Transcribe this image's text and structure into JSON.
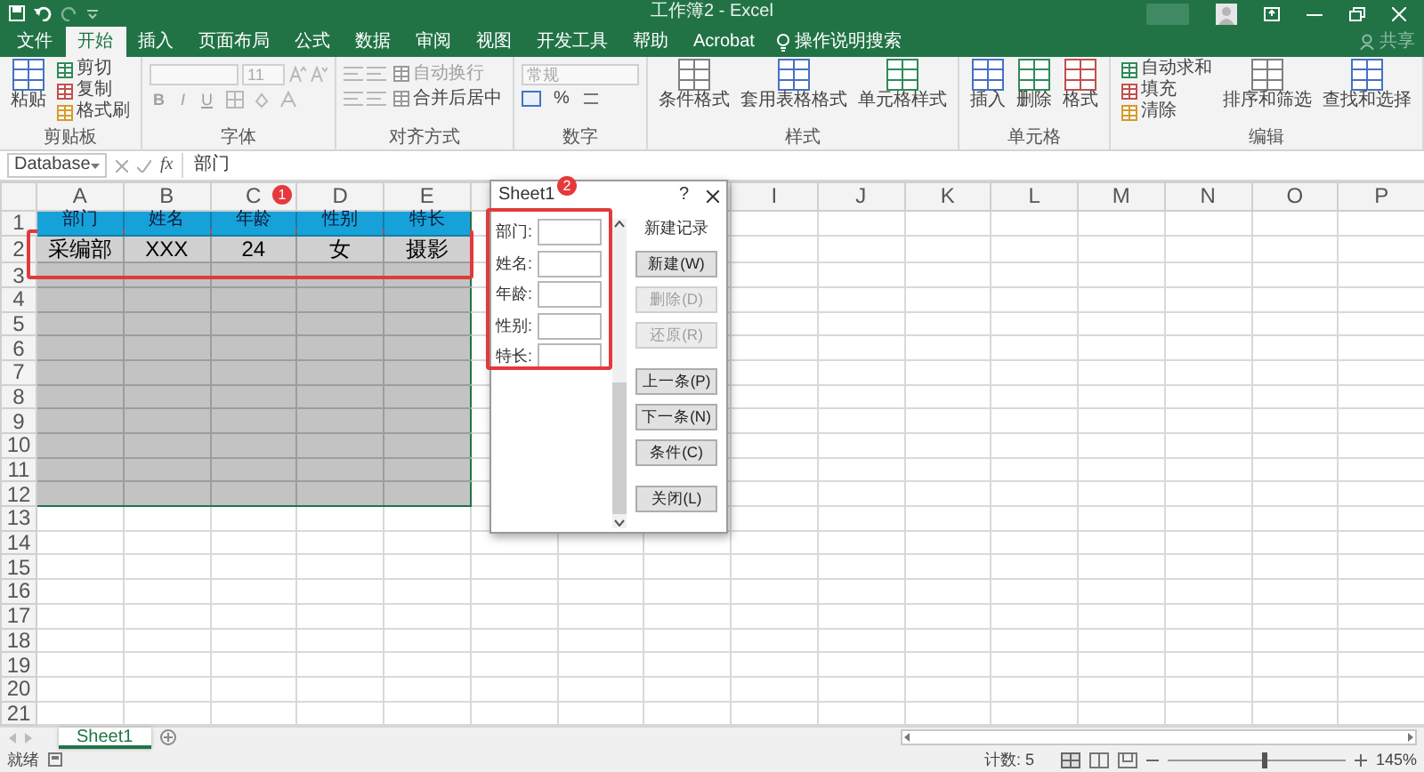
{
  "title_bar": {
    "title": "工作簿2  -  Excel"
  },
  "ribbon_tabs": [
    {
      "label": "文件",
      "selected": false
    },
    {
      "label": "开始",
      "selected": true
    },
    {
      "label": "插入",
      "selected": false
    },
    {
      "label": "页面布局",
      "selected": false
    },
    {
      "label": "公式",
      "selected": false
    },
    {
      "label": "数据",
      "selected": false
    },
    {
      "label": "审阅",
      "selected": false
    },
    {
      "label": "视图",
      "selected": false
    },
    {
      "label": "开发工具",
      "selected": false
    },
    {
      "label": "帮助",
      "selected": false
    },
    {
      "label": "Acrobat",
      "selected": false
    }
  ],
  "tell_me": "操作说明搜索",
  "share": "共享",
  "ribbon_groups": [
    {
      "label": "剪贴板",
      "kind": "buttons",
      "items": [
        {
          "label": "粘贴",
          "kind": "large"
        },
        {
          "label": "剪切",
          "kind": "small"
        },
        {
          "label": "复制",
          "kind": "small"
        },
        {
          "label": "格式刷",
          "kind": "small"
        }
      ]
    },
    {
      "label": "字体",
      "kind": "font",
      "size": "11",
      "styles": [
        "B",
        "I",
        "U"
      ]
    },
    {
      "label": "对齐方式",
      "kind": "align",
      "items": [
        {
          "label": "自动换行"
        },
        {
          "label": "合并后居中"
        }
      ]
    },
    {
      "label": "数字",
      "kind": "number",
      "format": "常规",
      "symbol": "%"
    },
    {
      "label": "样式",
      "kind": "buttons",
      "items": [
        {
          "label": "条件格式",
          "kind": "large"
        },
        {
          "label": "套用表格格式",
          "kind": "large"
        },
        {
          "label": "单元格样式",
          "kind": "large"
        }
      ]
    },
    {
      "label": "单元格",
      "kind": "buttons",
      "items": [
        {
          "label": "插入",
          "kind": "large"
        },
        {
          "label": "删除",
          "kind": "large"
        },
        {
          "label": "格式",
          "kind": "large"
        }
      ]
    },
    {
      "label": "编辑",
      "kind": "buttons",
      "items": [
        {
          "label": "自动求和",
          "kind": "small"
        },
        {
          "label": "填充",
          "kind": "small"
        },
        {
          "label": "清除",
          "kind": "small"
        },
        {
          "label": "排序和筛选",
          "kind": "large"
        },
        {
          "label": "查找和选择",
          "kind": "large"
        }
      ]
    }
  ],
  "formula_bar": {
    "name_box": "Database",
    "fx": "fx",
    "content": "部门"
  },
  "sheet": {
    "columns": [
      "A",
      "B",
      "C",
      "D",
      "E",
      null,
      null,
      null,
      "I",
      "J",
      "K",
      "L",
      "M",
      "N",
      "O",
      "P"
    ],
    "rows": [
      {
        "number": "1",
        "kind": "header",
        "cells": [
          "部门",
          "姓名",
          "年龄",
          "性别",
          "特长"
        ]
      },
      {
        "number": "2",
        "kind": "record",
        "cells": [
          "采编部",
          "XXX",
          "24",
          "女",
          "摄影"
        ]
      },
      {
        "number": "3",
        "kind": "blank"
      },
      {
        "number": "4",
        "kind": "blank"
      },
      {
        "number": "5",
        "kind": "blank"
      },
      {
        "number": "6",
        "kind": "blank"
      },
      {
        "number": "7",
        "kind": "blank"
      },
      {
        "number": "8",
        "kind": "blank"
      },
      {
        "number": "9",
        "kind": "blank"
      },
      {
        "number": "10",
        "kind": "blank"
      },
      {
        "number": "11",
        "kind": "blank"
      },
      {
        "number": "12",
        "kind": "blank"
      },
      {
        "number": "13",
        "kind": "empty"
      },
      {
        "number": "14",
        "kind": "empty"
      },
      {
        "number": "15",
        "kind": "empty"
      },
      {
        "number": "16",
        "kind": "empty"
      },
      {
        "number": "17",
        "kind": "empty"
      },
      {
        "number": "18",
        "kind": "empty"
      },
      {
        "number": "19",
        "kind": "empty"
      },
      {
        "number": "20",
        "kind": "empty"
      },
      {
        "number": "21",
        "kind": "empty"
      }
    ]
  },
  "dialog": {
    "title": "Sheet1",
    "help": "?",
    "fields": [
      {
        "label": "部门:"
      },
      {
        "label": "姓名:"
      },
      {
        "label": "年龄:"
      },
      {
        "label": "性别:"
      },
      {
        "label": "特长:"
      }
    ],
    "status": "新建记录",
    "button_groups": [
      [
        {
          "label": "新建(W)",
          "disabled": false
        },
        {
          "label": "删除(D)",
          "disabled": true
        },
        {
          "label": "还原(R)",
          "disabled": true
        }
      ],
      [
        {
          "label": "上一条(P)",
          "disabled": false
        },
        {
          "label": "下一条(N)",
          "disabled": false
        },
        {
          "label": "条件(C)",
          "disabled": false
        }
      ],
      [
        {
          "label": "关闭(L)",
          "disabled": false
        }
      ]
    ]
  },
  "annotations": {
    "badges": [
      "1",
      "2"
    ]
  },
  "sheet_tabs": [
    {
      "label": "Sheet1",
      "selected": true
    }
  ],
  "status_bar": {
    "status": "就绪",
    "count": "计数: 5",
    "zoom": {
      "reading": "145%",
      "level": 0.55
    }
  }
}
